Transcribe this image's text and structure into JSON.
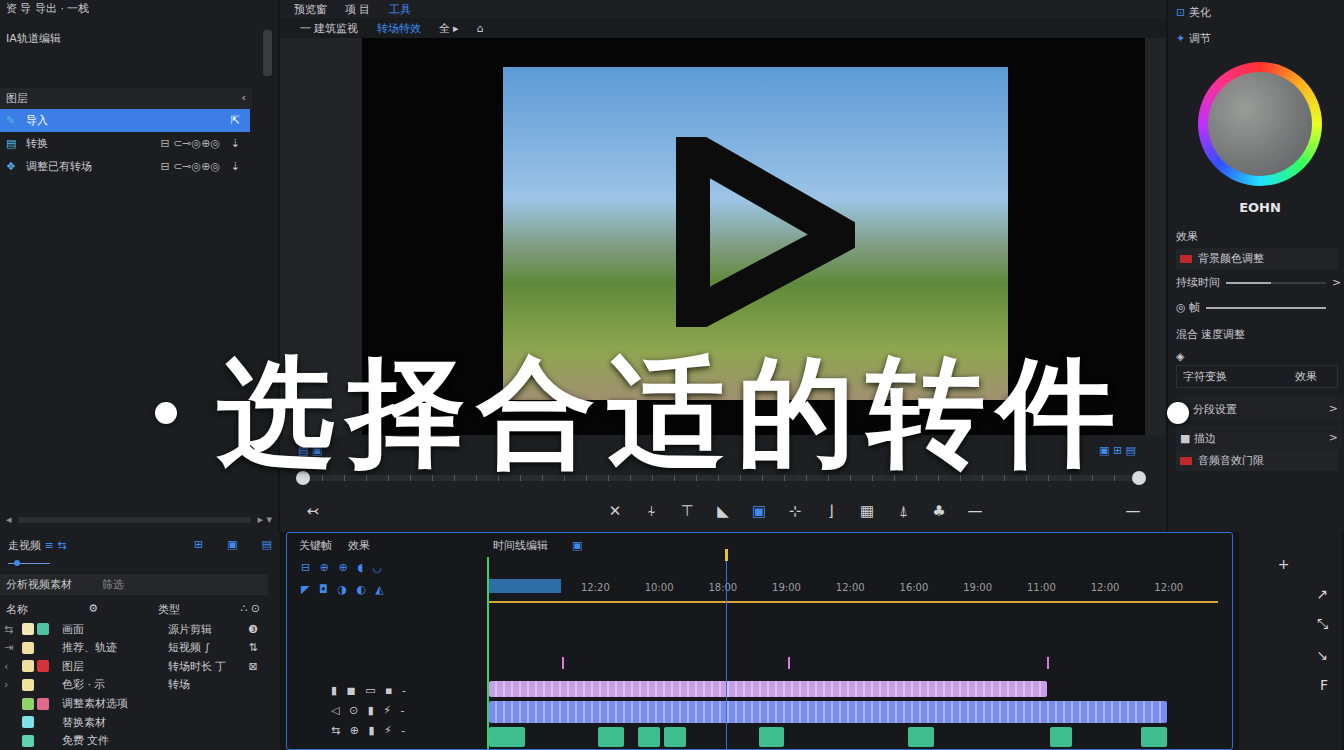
{
  "left_panel": {
    "title": "资 导  导出 · 一栈",
    "subtitle": "IA轨道编辑",
    "section_title": "图层",
    "section_toggle": "‹",
    "items": [
      {
        "icon": "✎",
        "label": "导入",
        "meta": "",
        "action": "⇱",
        "selected": true
      },
      {
        "icon": "▤",
        "label": "转换",
        "meta": "⊟ ⊂⊸◎⊕◎",
        "action": "⇣",
        "selected": false
      },
      {
        "icon": "❖",
        "label": "调整已有转场",
        "meta": "⊟ ⊂⊸◎⊕◎",
        "action": "⇣",
        "selected": false
      }
    ],
    "scroll_left": "◂",
    "scroll_right": "▸ ▾"
  },
  "preview": {
    "tabs": [
      {
        "label": "预览窗",
        "selected": false
      },
      {
        "label": "项 目",
        "selected": false
      },
      {
        "label": "工具",
        "selected": true
      }
    ],
    "subtabs": [
      {
        "label": "一 建筑监视",
        "selected": false
      },
      {
        "label": "转场特效",
        "selected": true
      },
      {
        "label": "全 ▸",
        "selected": false
      },
      {
        "label": "⌂",
        "selected": false
      }
    ],
    "strip_left": "▤ ▣",
    "strip_right": "▣ ⊞ ▤",
    "scrubber": {
      "level": 0.0
    },
    "toolbar_left": "↢",
    "toolbar_right": "—",
    "tools": [
      {
        "glyph": "✕",
        "selected": false
      },
      {
        "glyph": "⍭",
        "selected": false
      },
      {
        "glyph": "⊤",
        "selected": false
      },
      {
        "glyph": "◣",
        "selected": false
      },
      {
        "glyph": "▣",
        "selected": true
      },
      {
        "glyph": "⊹",
        "selected": false
      },
      {
        "glyph": "⌋",
        "selected": false
      },
      {
        "glyph": "▦",
        "selected": false
      },
      {
        "glyph": "⍋",
        "selected": false
      },
      {
        "glyph": "♣",
        "selected": false
      },
      {
        "glyph": "—",
        "selected": false
      }
    ]
  },
  "right_panel": {
    "tabs": [
      {
        "icon": "⊡",
        "label": "美化"
      },
      {
        "icon": "✦",
        "label": "调节"
      }
    ],
    "wheel_label": "EOHN",
    "rows": [
      {
        "kind": "title",
        "icon": "",
        "label": "效果",
        "extra": "",
        "level": 0,
        "arrow": ""
      },
      {
        "kind": "chip",
        "icon": "",
        "label": "背景颜色调整",
        "extra": "",
        "level": 0,
        "arrow": ""
      },
      {
        "kind": "slider",
        "icon": "",
        "label": "持续时间",
        "extra": "",
        "level": 0.45,
        "arrow": ">"
      },
      {
        "kind": "slider",
        "icon": "◎",
        "label": "帧",
        "extra": "",
        "level": 1.0,
        "arrow": ""
      },
      {
        "kind": "title",
        "icon": "",
        "label": "混合 速度调整",
        "extra": "",
        "level": 0,
        "arrow": ""
      },
      {
        "kind": "box",
        "icon": "◈",
        "label": "字符变换",
        "extra": "效果",
        "level": 0,
        "arrow": ""
      },
      {
        "kind": "nav",
        "icon": "♠",
        "label": "分段设置",
        "extra": "",
        "level": 0,
        "arrow": ">"
      },
      {
        "kind": "nav",
        "icon": "■",
        "label": "描边",
        "extra": "",
        "level": 0,
        "arrow": ">"
      },
      {
        "kind": "chip",
        "icon": "",
        "label": "音频音效门限",
        "extra": "",
        "level": 0,
        "arrow": ""
      }
    ]
  },
  "library": {
    "title": "走视频",
    "title_icons": "≡ ⇆",
    "view_icons": [
      "⊞",
      "▣",
      "▤"
    ],
    "slider": {
      "level": 0.15
    },
    "search": "分析视频素材",
    "filter": "筛选",
    "columns": [
      "名称",
      "⚙",
      "类型",
      "∴ ⊙"
    ],
    "rows": [
      {
        "expand": "⇆",
        "colors": [
          "#f1e7b5",
          "#4fc3a1"
        ],
        "name": "画面",
        "type": "源片剪辑",
        "badge": "❸"
      },
      {
        "expand": "⇥",
        "colors": [
          "#f0e0a0"
        ],
        "name": "推荐、轨迹",
        "type": "短视频 ∫",
        "badge": "⇅"
      },
      {
        "expand": "‹",
        "colors": [
          "#f0e0a0",
          "#d8323c"
        ],
        "name": "图层",
        "type": "转场时长 丁",
        "badge": "⊠"
      },
      {
        "expand": "›",
        "colors": [
          "#f3e29c"
        ],
        "name": "色彩 · 示",
        "type": "转场",
        "badge": ""
      },
      {
        "expand": "",
        "colors": [
          "#8fd36a",
          "#e06a8a"
        ],
        "name": "调整素材选项",
        "type": "",
        "badge": ""
      },
      {
        "expand": "",
        "colors": [
          "#7fe0e6"
        ],
        "name": "替换素材",
        "type": "",
        "badge": ""
      },
      {
        "expand": "",
        "colors": [
          "#5fd3b0"
        ],
        "name": "免费 文件",
        "type": "",
        "badge": ""
      }
    ]
  },
  "timeline": {
    "tabs": [
      "关键帧",
      "效果"
    ],
    "title": "时间线编辑",
    "title_icon": "▣",
    "controls": [
      "⊟ ⊕ ⊕ ◖ ◡",
      "◤ ◘ ◑ ◐ ◭"
    ],
    "ruler": [
      "",
      "12:20",
      "10:00",
      "18:00",
      "19:00",
      "12:00",
      "16:00",
      "19:00",
      "11:00",
      "12:00",
      "12:00"
    ],
    "playhead": 0.325,
    "markers": [
      0.1,
      0.41,
      0.765
    ],
    "tracks": [
      {
        "kind": "bar",
        "icons": "▮ ◼ ▭ ▪ -",
        "color": "#c9a0e8",
        "segments": [
          [
            0,
            0.765
          ]
        ]
      },
      {
        "kind": "bar",
        "icons": "◁ ⊙ ▮ ⚡ -",
        "color": "#7b8cf0",
        "segments": [
          [
            0,
            0.93
          ]
        ]
      },
      {
        "kind": "clips",
        "icons": "⇆ ⊕ ▮ ⚡ -",
        "color": "#3fbf8f",
        "segments": [
          [
            0,
            0.05
          ],
          [
            0.15,
            0.185
          ],
          [
            0.205,
            0.235
          ],
          [
            0.24,
            0.27
          ],
          [
            0.37,
            0.405
          ],
          [
            0.575,
            0.61
          ],
          [
            0.77,
            0.8
          ],
          [
            0.895,
            0.93
          ]
        ]
      }
    ]
  },
  "tools": [
    "+",
    "↗",
    "⤡",
    "↘",
    "F"
  ],
  "caption": {
    "text": "选择合适的转件"
  }
}
